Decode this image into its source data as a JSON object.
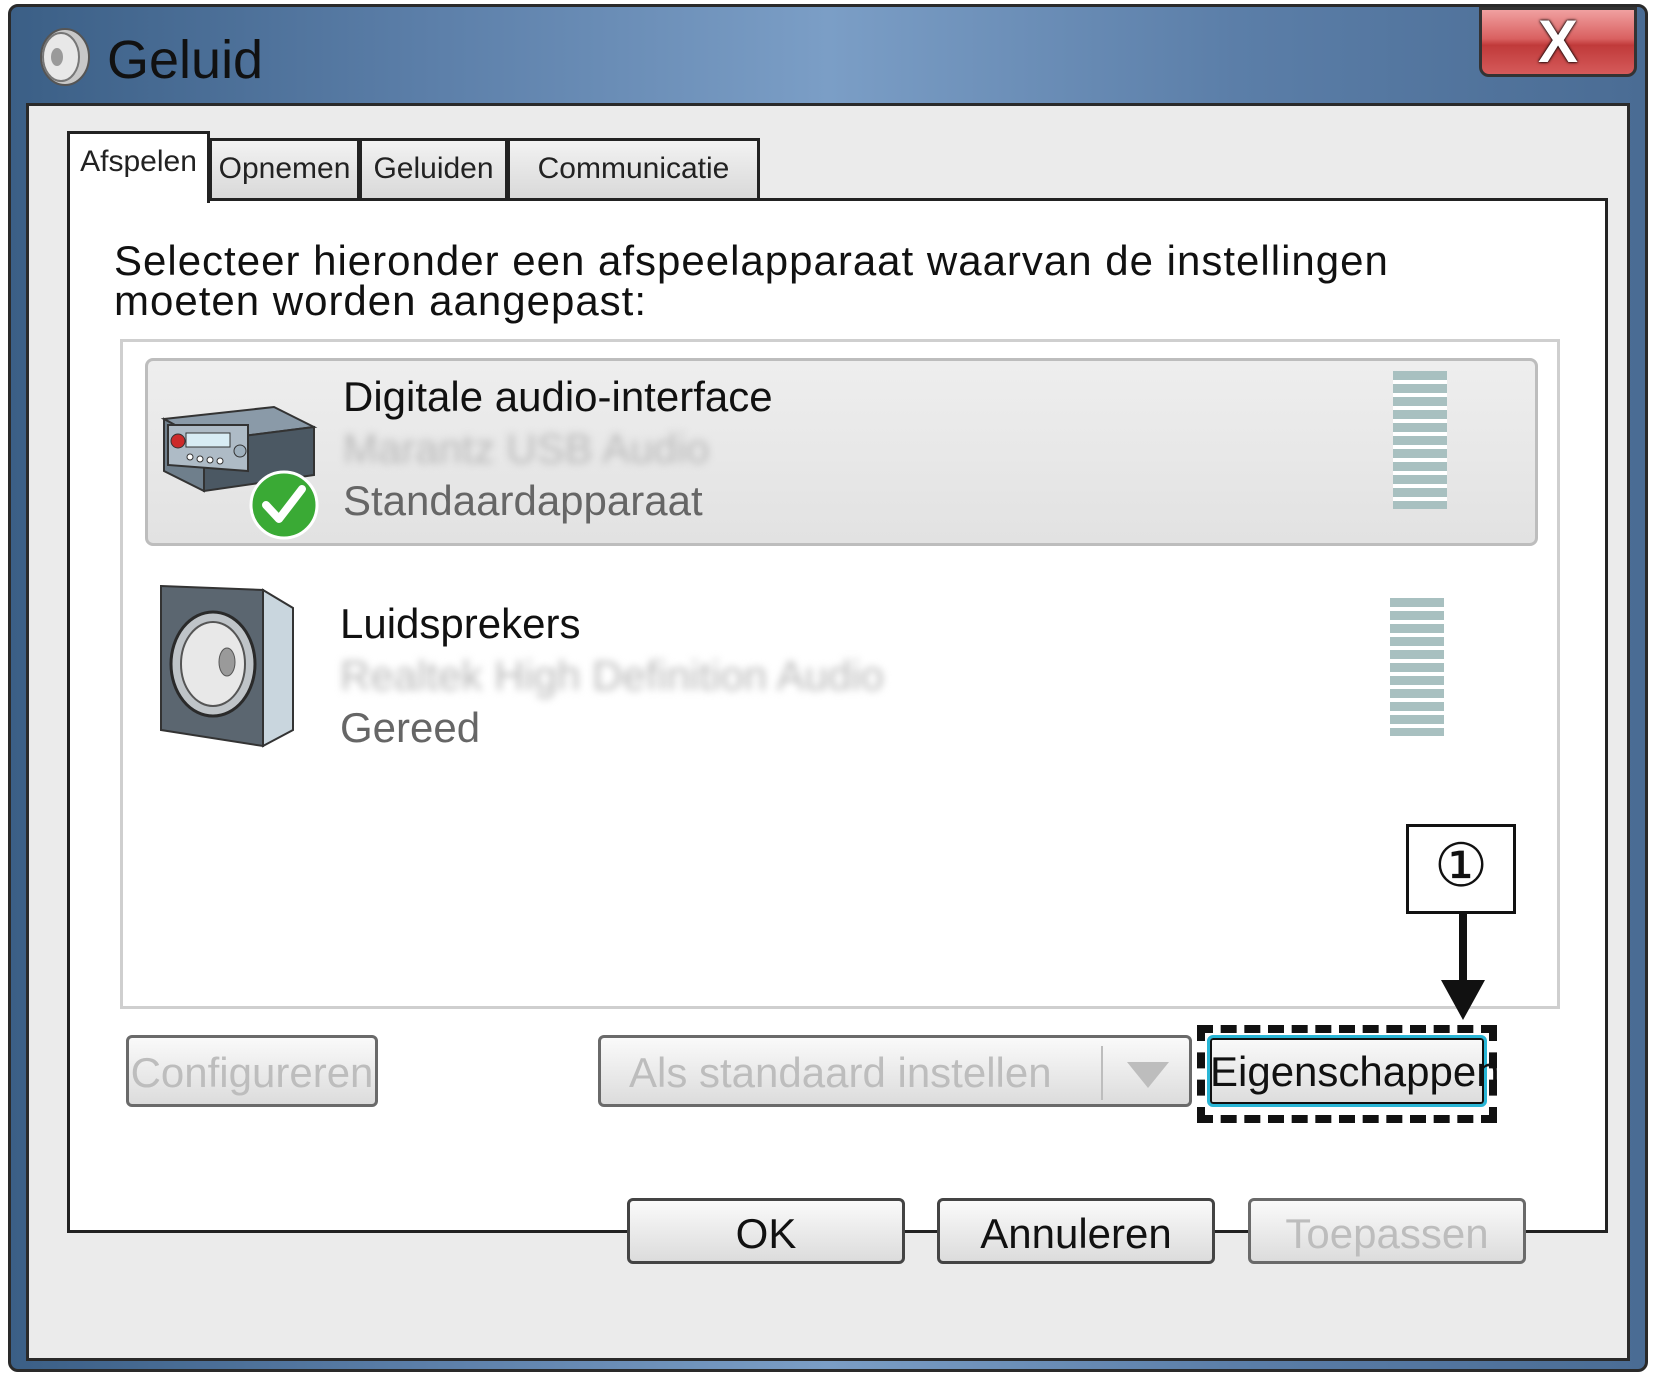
{
  "window": {
    "title": "Geluid",
    "close_label": "X"
  },
  "tabs": [
    "Afspelen",
    "Opnemen",
    "Geluiden",
    "Communicatie"
  ],
  "instruction": "Selecteer hieronder een afspeelapparaat waarvan de instellingen moeten worden aangepast:",
  "devices": [
    {
      "name": "Digitale audio-interface",
      "driver": "Marantz USB Audio",
      "status": "Standaardapparaat",
      "icon": "audio-interface-icon",
      "default": true
    },
    {
      "name": "Luidsprekers",
      "driver": "Realtek High Definition Audio",
      "status": "Gereed",
      "icon": "speaker-icon",
      "default": false
    }
  ],
  "buttons": {
    "configure": "Configureren",
    "set_default": "Als standaard instellen",
    "properties": "Eigenschappen",
    "ok": "OK",
    "cancel": "Annuleren",
    "apply": "Toepassen"
  },
  "annotation": {
    "marker": "①"
  },
  "colors": {
    "close": "#d24a4a",
    "check": "#3aaa35",
    "focus": "#29b6d6"
  }
}
